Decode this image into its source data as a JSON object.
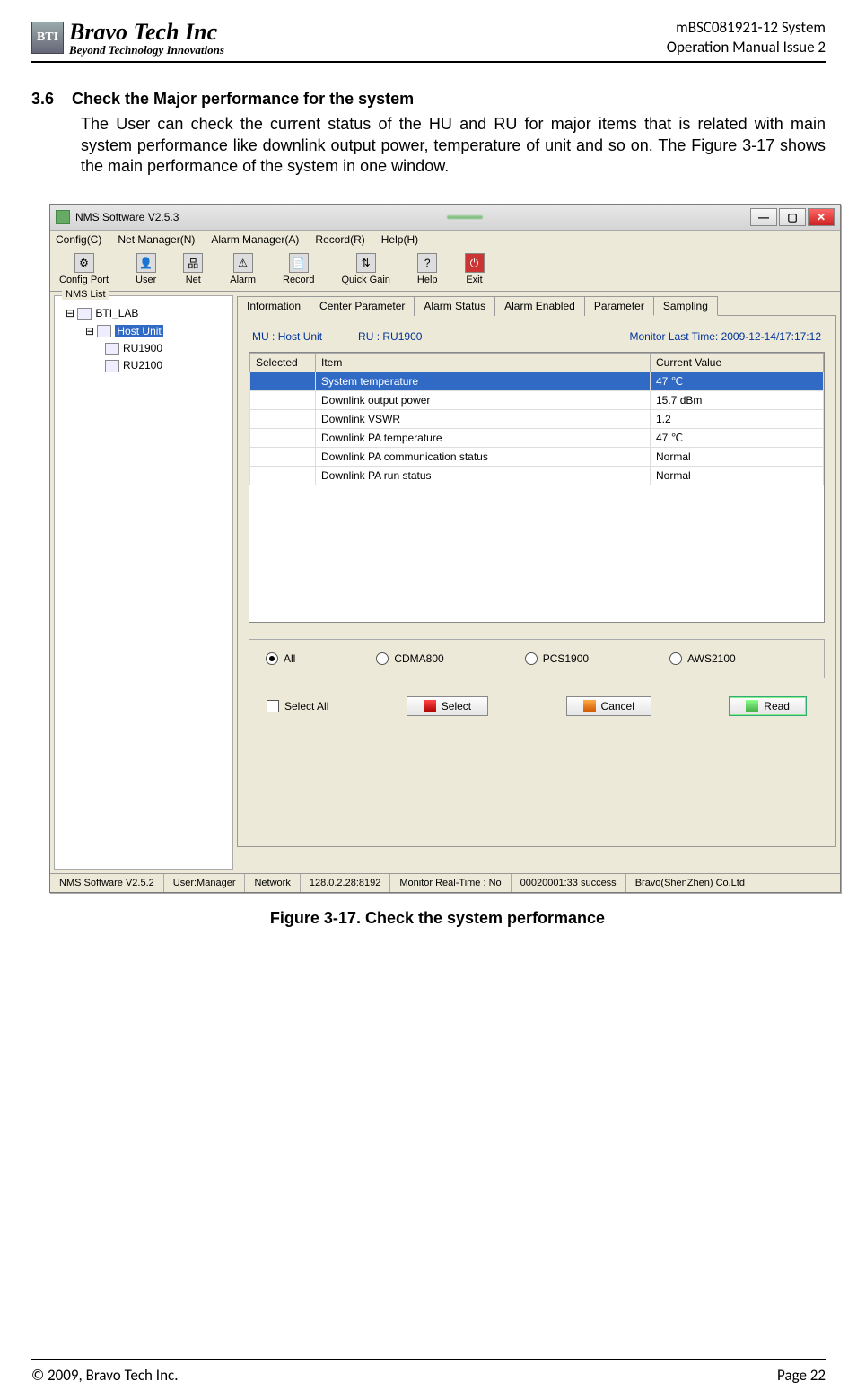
{
  "header": {
    "logo_abbr": "BTI",
    "logo_main": "Bravo Tech Inc",
    "logo_sub": "Beyond Technology Innovations",
    "doc_title_l1": "mBSC081921-12 System",
    "doc_title_l2": "Operation Manual Issue 2"
  },
  "section": {
    "num": "3.6",
    "title": "Check the Major performance for the system",
    "body": "The User can check the current status of the HU and RU for major items that is related with main system performance like downlink output power, temperature of unit and so on. The Figure 3-17 shows the main performance of the system in one window."
  },
  "app": {
    "title": "NMS Software V2.5.3",
    "title_blur": "",
    "menus": [
      "Config(C)",
      "Net Manager(N)",
      "Alarm Manager(A)",
      "Record(R)",
      "Help(H)"
    ],
    "tools": [
      "Config Port",
      "User",
      "Net",
      "Alarm",
      "Record",
      "Quick Gain",
      "Help",
      "Exit"
    ],
    "nms_label": "NMS List",
    "tree": {
      "root": "BTI_LAB",
      "host": "Host Unit",
      "ru1": "RU1900",
      "ru2": "RU2100"
    },
    "tabs": [
      "Information",
      "Center Parameter",
      "Alarm Status",
      "Alarm Enabled",
      "Parameter",
      "Sampling"
    ],
    "info": {
      "mu_label": "MU :",
      "mu_value": "Host Unit",
      "ru_label": "RU :",
      "ru_value": "RU1900",
      "mlt_label": "Monitor Last Time:",
      "mlt_value": "2009-12-14/17:17:12"
    },
    "cols": [
      "Selected",
      "Item",
      "Current Value"
    ],
    "rows": [
      {
        "item": "System temperature",
        "value": "47 ℃",
        "sel": true
      },
      {
        "item": "Downlink output power",
        "value": "15.7 dBm",
        "sel": false
      },
      {
        "item": "Downlink VSWR",
        "value": "1.2",
        "sel": false
      },
      {
        "item": "Downlink PA temperature",
        "value": "47 ℃",
        "sel": false
      },
      {
        "item": "Downlink PA communication status",
        "value": "Normal",
        "sel": false
      },
      {
        "item": "Downlink PA run status",
        "value": "Normal",
        "sel": false
      }
    ],
    "radios": [
      "All",
      "CDMA800",
      "PCS1900",
      "AWS2100"
    ],
    "select_all": "Select All",
    "btn_select": "Select",
    "btn_cancel": "Cancel",
    "btn_read": "Read",
    "status": [
      "NMS Software V2.5.2",
      "User:Manager",
      "Network",
      "128.0.2.28:8192",
      "Monitor Real-Time : No",
      "00020001:33 success",
      "Bravo(ShenZhen) Co.Ltd"
    ]
  },
  "figure_caption": "Figure 3-17. Check the system performance",
  "footer": {
    "left": "© 2009, Bravo Tech Inc.",
    "right": "Page 22"
  }
}
